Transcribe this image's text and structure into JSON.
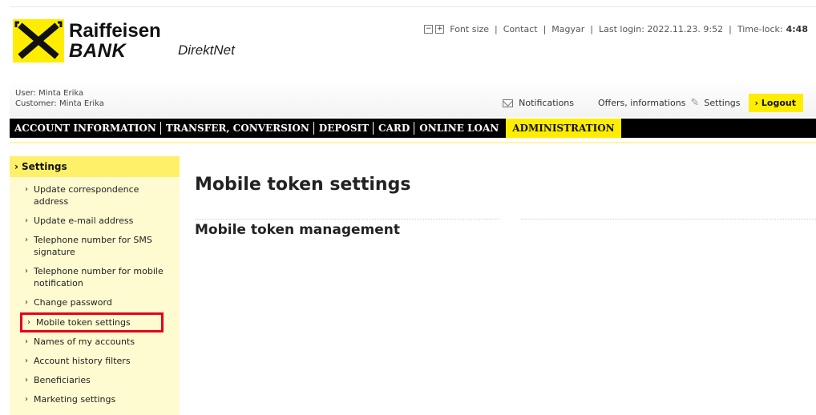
{
  "brand": {
    "name_line1": "Raiffeisen",
    "name_line2": "BANK",
    "product": "DirektNet",
    "logo_color": "#ffed00"
  },
  "utility": {
    "font_minus": "−",
    "font_plus": "+",
    "font_size": "Font size",
    "contact": "Contact",
    "language": "Magyar",
    "last_login": "Last login: 2022.11.23. 9:52",
    "timelock_label": "Time-lock:",
    "timelock_value": "4:48"
  },
  "user": {
    "user_line": "User: Minta Erika",
    "customer_line": "Customer: Minta Erika"
  },
  "actions": {
    "notifications": "Notifications",
    "offers": "Offers, informations",
    "settings": "Settings",
    "logout": "Logout",
    "logout_icon": "›"
  },
  "nav": {
    "items": [
      "ACCOUNT INFORMATION",
      "TRANSFER, CONVERSION",
      "DEPOSIT",
      "CARD",
      "ONLINE LOAN"
    ],
    "active": "ADMINISTRATION",
    "active_color": "#ffed00"
  },
  "sidebar": {
    "heading": "Settings",
    "items": [
      "Update correspondence address",
      "Update e-mail address",
      "Telephone number for SMS signature",
      "Telephone number for mobile notification",
      "Change password",
      "Mobile token settings",
      "Names of my accounts",
      "Account history filters",
      "Beneficiaries",
      "Marketing settings"
    ],
    "highlight_color": "#e3001b"
  },
  "main": {
    "title": "Mobile token settings",
    "section_title": "Mobile token management"
  }
}
